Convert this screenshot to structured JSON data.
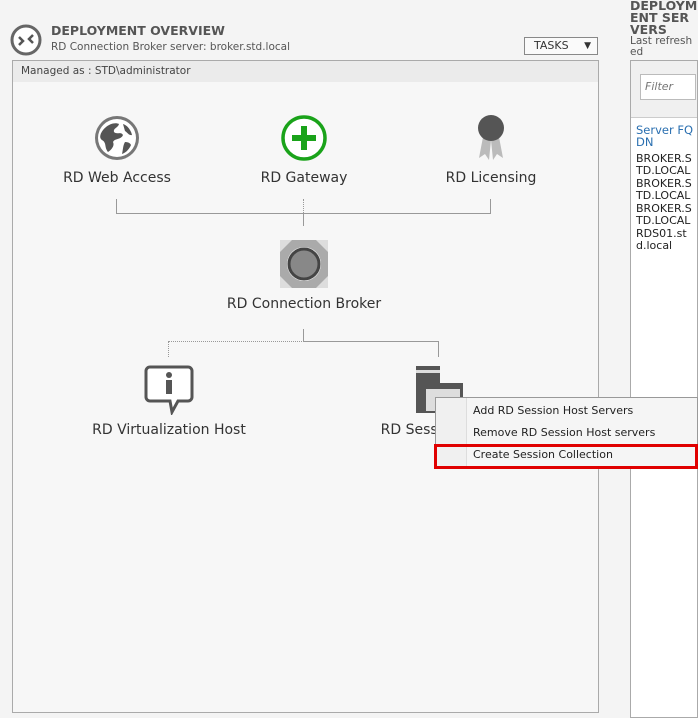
{
  "overview": {
    "title": "DEPLOYMENT OVERVIEW",
    "subtitle": "RD Connection Broker server: broker.std.local",
    "tasks_label": "TASKS",
    "managed_as": "Managed as : STD\\administrator"
  },
  "roles": {
    "web_access": "RD Web Access",
    "gateway": "RD Gateway",
    "licensing": "RD Licensing",
    "broker": "RD Connection Broker",
    "virtualization": "RD Virtualization Host",
    "session_host": "RD Session Host"
  },
  "servers": {
    "title": "DEPLOYMENT SERVERS",
    "subtitle": "Last refreshed",
    "filter_placeholder": "Filter",
    "column": "Server FQDN",
    "rows": [
      "BROKER.STD.LOCAL",
      "BROKER.STD.LOCAL",
      "BROKER.STD.LOCAL",
      "RDS01.std.local"
    ]
  },
  "context_menu": {
    "items": [
      "Add RD Session Host Servers",
      "Remove RD Session Host servers",
      "Create Session Collection"
    ],
    "highlighted": "Create Session Collection"
  },
  "colors": {
    "gateway_green": "#1aa31a",
    "highlight_red": "#e00000",
    "link_blue": "#2a6fb0"
  }
}
